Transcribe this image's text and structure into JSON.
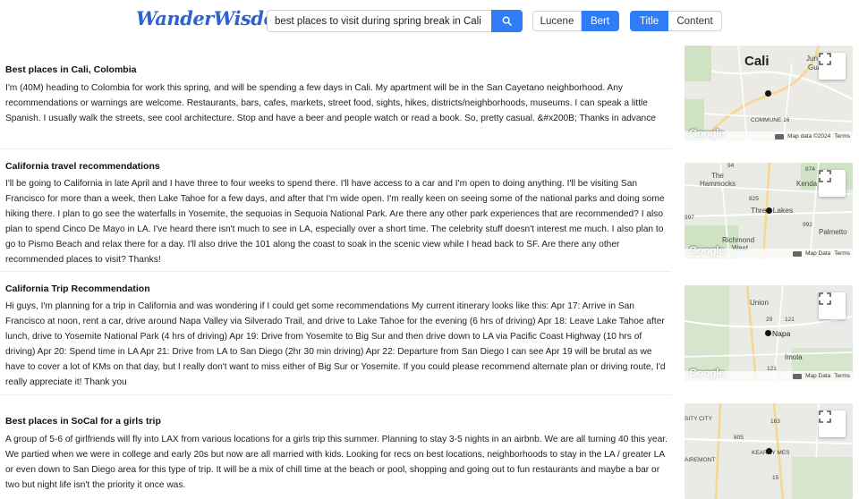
{
  "brand": {
    "logo_text": "WanderWisdom",
    "accent": "#2f7cf6"
  },
  "search": {
    "value": "best places to visit during spring break in Cali",
    "button_icon": "search-icon"
  },
  "engine_toggle": {
    "options": [
      "Lucene",
      "Bert"
    ],
    "selected": "Bert"
  },
  "field_toggle": {
    "options": [
      "Title",
      "Content"
    ],
    "selected": "Title"
  },
  "results": [
    {
      "title": "Best places in Cali, Colombia",
      "body": "I'm (40M) heading to Colombia for work this spring, and will be spending a few days in Cali. My apartment will be in the San Cayetano neighborhood. Any recommendations or warnings are welcome. Restaurants, bars, cafes, markets, street food, sights, hikes, districts/neighborhoods, museums. I can speak a little Spanish. I usually walk the streets, see cool architecture. Stop and have a beer and people watch or read a book. So, pretty casual. &#x200B; Thanks in advance",
      "map": {
        "labels": [
          "Cali",
          "Jun",
          "Gua",
          "COMMUNE 16"
        ],
        "attribution": "Map data ©2024",
        "terms": "Terms",
        "google": "Google"
      }
    },
    {
      "title": "California travel recommendations",
      "body": "I'll be going to California in late April and I have three to four weeks to spend there. I'll have access to a car and I'm open to doing anything. I'll be visiting San Francisco for more than a week, then Lake Tahoe for a few days, and after that I'm wide open. I'm really keen on seeing some of the national parks and doing some hiking there. I plan to go see the waterfalls in Yosemite, the sequoias in Sequoia National Park. Are there any other park experiences that are recommended? I also plan to spend Cinco De Mayo in LA. I've heard there isn't much to see in LA, especially over a short time. The celebrity stuff doesn't interest me much. I also plan to go to Pismo Beach and relax there for a day. I'll also drive the 101 along the coast to soak in the scenic view while I head back to SF. Are there any other recommended places to visit? Thanks!",
      "map": {
        "labels": [
          "The",
          "Hammocks",
          "Kenda",
          "Three Lakes",
          "Richmond",
          "West",
          "Palmetto",
          "94",
          "874",
          "825",
          "997",
          "992"
        ],
        "attribution": "Map Data",
        "terms": "Terms",
        "google": "Google"
      }
    },
    {
      "title": "California Trip Recommendation",
      "body": "Hi guys, I'm planning for a trip in California and was wondering if I could get some recommendations My current itinerary looks like this: Apr 17: Arrive in San Francisco at noon, rent a car, drive around Napa Valley via Silverado Trail, and drive to Lake Tahoe for the evening (6 hrs of driving) Apr 18: Leave Lake Tahoe after lunch, drive to Yosemite National Park (4 hrs of driving) Apr 19: Drive from Yosemite to Big Sur and then drive down to LA via Pacific Coast Highway (10 hrs of driving) Apr 20: Spend time in LA Apr 21: Drive from LA to San Diego (2hr 30 min driving) Apr 22: Departure from San Diego I can see Apr 19 will be brutal as we have to cover a lot of KMs on that day, but I really don't want to miss either of Big Sur or Yosemite. If you could please recommend alternate plan or driving route, I'd really appreciate it! Thank you",
      "map": {
        "labels": [
          "Union",
          "29",
          "121",
          "Napa",
          "Imola",
          "121"
        ],
        "attribution": "Map Data",
        "terms": "Terms",
        "google": "Google"
      }
    },
    {
      "title": "Best places in SoCal for a girls trip",
      "body": "A group of 5-6 of girlfriends will fly into LAX from various locations for a girls trip this summer. Planning to stay 3-5 nights in an airbnb. We are all turning 40 this year. We partied when we were in college and early 20s but now are all married with kids. Looking for recs on best locations, neighborhoods to stay in the LA / greater LA or even down to San Diego area for this type of trip. It will be a mix of chill time at the beach or pool, shopping and going out to fun restaurants and maybe a bar or two but night life isn't the priority it once was.",
      "map": {
        "labels": [
          "SITY CITY",
          "163",
          "805",
          "AIREMONT",
          "KEARNY MES",
          "15"
        ],
        "attribution": "",
        "terms": "",
        "google": ""
      }
    }
  ]
}
